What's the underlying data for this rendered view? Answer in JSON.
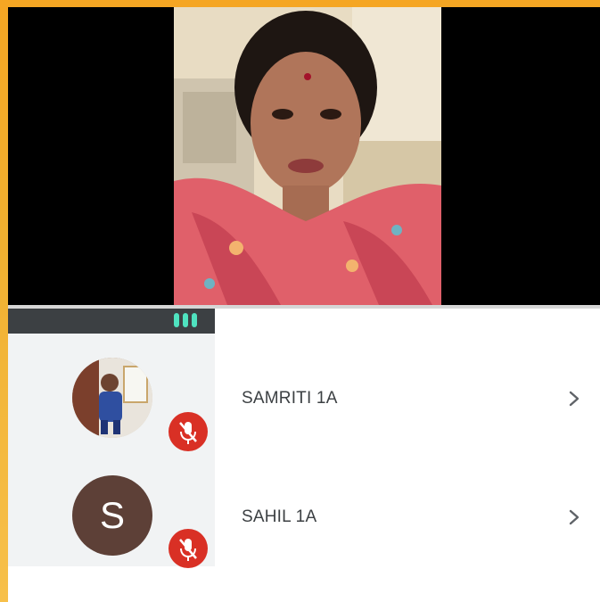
{
  "main_video": {
    "subject": "presenter-video-feed"
  },
  "participants": [
    {
      "name": "SAMRITI 1A",
      "avatar_type": "photo",
      "mic": "muted"
    },
    {
      "name": "SAHIL 1A",
      "avatar_type": "letter",
      "avatar_letter": "S",
      "mic": "muted"
    }
  ],
  "colors": {
    "mute_badge": "#d93025",
    "audio_indicator": "#4fe3c0",
    "avatar_letter_bg": "#5d4037",
    "frame_border": "#f5a623"
  },
  "icons": {
    "muted_mic": "mic-off-icon",
    "open_details": "chevron-right-icon",
    "speaking": "audio-level-icon"
  }
}
